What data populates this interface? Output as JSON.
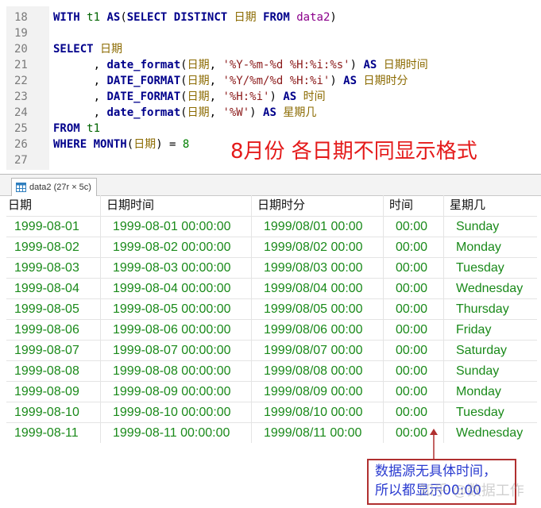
{
  "editor": {
    "lines": [
      {
        "n": "18",
        "tokens": [
          [
            "kw",
            "WITH"
          ],
          [
            "punct",
            " "
          ],
          [
            "id",
            "t1"
          ],
          [
            "punct",
            " "
          ],
          [
            "kw",
            "AS"
          ],
          [
            "punct",
            "("
          ],
          [
            "kw",
            "SELECT"
          ],
          [
            "punct",
            " "
          ],
          [
            "kw",
            "DISTINCT"
          ],
          [
            "punct",
            " "
          ],
          [
            "col",
            "日期"
          ],
          [
            "punct",
            " "
          ],
          [
            "kw",
            "FROM"
          ],
          [
            "punct",
            " "
          ],
          [
            "tbl",
            "data2"
          ],
          [
            "punct",
            ")"
          ]
        ]
      },
      {
        "n": "19",
        "tokens": []
      },
      {
        "n": "20",
        "tokens": [
          [
            "kw",
            "SELECT"
          ],
          [
            "punct",
            " "
          ],
          [
            "col",
            "日期"
          ]
        ]
      },
      {
        "n": "21",
        "tokens": [
          [
            "punct",
            "      , "
          ],
          [
            "fn",
            "date_format"
          ],
          [
            "punct",
            "("
          ],
          [
            "col",
            "日期"
          ],
          [
            "punct",
            ", "
          ],
          [
            "str",
            "'%Y-%m-%d %H:%i:%s'"
          ],
          [
            "punct",
            ") "
          ],
          [
            "kw",
            "AS"
          ],
          [
            "punct",
            " "
          ],
          [
            "col",
            "日期时间"
          ]
        ]
      },
      {
        "n": "22",
        "tokens": [
          [
            "punct",
            "      , "
          ],
          [
            "fn",
            "DATE_FORMAT"
          ],
          [
            "punct",
            "("
          ],
          [
            "col",
            "日期"
          ],
          [
            "punct",
            ", "
          ],
          [
            "str",
            "'%Y/%m/%d %H:%i'"
          ],
          [
            "punct",
            ") "
          ],
          [
            "kw",
            "AS"
          ],
          [
            "punct",
            " "
          ],
          [
            "col",
            "日期时分"
          ]
        ]
      },
      {
        "n": "23",
        "tokens": [
          [
            "punct",
            "      , "
          ],
          [
            "fn",
            "DATE_FORMAT"
          ],
          [
            "punct",
            "("
          ],
          [
            "col",
            "日期"
          ],
          [
            "punct",
            ", "
          ],
          [
            "str",
            "'%H:%i'"
          ],
          [
            "punct",
            ") "
          ],
          [
            "kw",
            "AS"
          ],
          [
            "punct",
            " "
          ],
          [
            "col",
            "时间"
          ]
        ]
      },
      {
        "n": "24",
        "tokens": [
          [
            "punct",
            "      , "
          ],
          [
            "fn",
            "date_format"
          ],
          [
            "punct",
            "("
          ],
          [
            "col",
            "日期"
          ],
          [
            "punct",
            ", "
          ],
          [
            "str",
            "'%W'"
          ],
          [
            "punct",
            ") "
          ],
          [
            "kw",
            "AS"
          ],
          [
            "punct",
            " "
          ],
          [
            "col",
            "星期几"
          ]
        ]
      },
      {
        "n": "25",
        "tokens": [
          [
            "kw",
            "FROM"
          ],
          [
            "punct",
            " "
          ],
          [
            "id",
            "t1"
          ]
        ]
      },
      {
        "n": "26",
        "tokens": [
          [
            "kw",
            "WHERE"
          ],
          [
            "punct",
            " "
          ],
          [
            "fn",
            "MONTH"
          ],
          [
            "punct",
            "("
          ],
          [
            "col",
            "日期"
          ],
          [
            "punct",
            ") = "
          ],
          [
            "num",
            "8"
          ]
        ]
      },
      {
        "n": "27",
        "tokens": []
      }
    ],
    "annotation": "8月份  各日期不同显示格式"
  },
  "tab": {
    "label": "data2 (27r × 5c)",
    "icon": "table-grid-icon"
  },
  "table": {
    "columns": [
      "日期",
      "日期时间",
      "日期时分",
      "时间",
      "星期几"
    ],
    "rows": [
      [
        "1999-08-01",
        "1999-08-01 00:00:00",
        "1999/08/01 00:00",
        "00:00",
        "Sunday"
      ],
      [
        "1999-08-02",
        "1999-08-02 00:00:00",
        "1999/08/02 00:00",
        "00:00",
        "Monday"
      ],
      [
        "1999-08-03",
        "1999-08-03 00:00:00",
        "1999/08/03 00:00",
        "00:00",
        "Tuesday"
      ],
      [
        "1999-08-04",
        "1999-08-04 00:00:00",
        "1999/08/04 00:00",
        "00:00",
        "Wednesday"
      ],
      [
        "1999-08-05",
        "1999-08-05 00:00:00",
        "1999/08/05 00:00",
        "00:00",
        "Thursday"
      ],
      [
        "1999-08-06",
        "1999-08-06 00:00:00",
        "1999/08/06 00:00",
        "00:00",
        "Friday"
      ],
      [
        "1999-08-07",
        "1999-08-07 00:00:00",
        "1999/08/07 00:00",
        "00:00",
        "Saturday"
      ],
      [
        "1999-08-08",
        "1999-08-08 00:00:00",
        "1999/08/08 00:00",
        "00:00",
        "Sunday"
      ],
      [
        "1999-08-09",
        "1999-08-09 00:00:00",
        "1999/08/09 00:00",
        "00:00",
        "Monday"
      ],
      [
        "1999-08-10",
        "1999-08-10 00:00:00",
        "1999/08/10 00:00",
        "00:00",
        "Tuesday"
      ],
      [
        "1999-08-11",
        "1999-08-11 00:00:00",
        "1999/08/11 00:00",
        "00:00",
        "Wednesday"
      ]
    ]
  },
  "callout": {
    "line1": "数据源无具体时间，",
    "line2": "所以都显示00:00"
  },
  "watermark": "知乎 @数据工作",
  "colors": {
    "keyword": "#00008b",
    "string": "#8b1a1a",
    "column": "#8b6a00",
    "table": "#8b008b",
    "cell_text": "#1a8a1a",
    "annotation": "#e41a1a",
    "callout_border": "#b03030",
    "callout_text": "#2a3bd0"
  }
}
